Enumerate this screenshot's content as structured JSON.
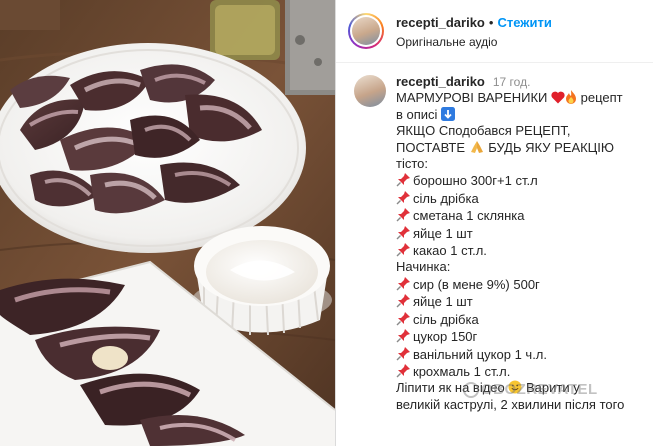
{
  "header": {
    "username": "recepti_dariko",
    "separator": "•",
    "follow_label": "Стежити",
    "audio_label": "Оригінальне аудіо"
  },
  "comment": {
    "username": "recepti_dariko",
    "time": "17 год.",
    "title_text": "МАРМУРОВІ ВАРЕНИКИ",
    "title_suffix": "рецепт",
    "line2": "в описі",
    "line3": "ЯКЩО Сподобався РЕЦЕПТ,",
    "line4a": "ПОСТАВТЕ",
    "line4b": "БУДЬ ЯКУ РЕАКЦІЮ",
    "dough_heading": "тісто:",
    "dough_items": [
      "борошно 300г+1 ст.л",
      "сіль дрібка",
      "сметана 1 склянка",
      "яйце 1 шт",
      "какао 1 ст.л."
    ],
    "filling_heading": "Начинка:",
    "filling_items": [
      "сир (в мене 9%) 500г",
      "яйце 1 шт",
      "сіль дрібка",
      "цукор 150г",
      "ванільний цукор 1 ч.л.",
      "крохмаль 1 ст.л."
    ],
    "closing_a": "Ліпити як на відео",
    "closing_b": "Варити у",
    "closing_c": "великій каструлі, 2 хвилини після того"
  },
  "watermark": "OBOZREVATEL",
  "icons": {
    "heart": "red-heart-icon",
    "fire": "fire-icon",
    "info": "info-icon",
    "pray": "folded-hands-icon",
    "pin": "pushpin-icon",
    "smile": "smiling-face-icon"
  },
  "colors": {
    "follow": "#0095f6",
    "text": "#262626",
    "muted": "#8e8e8e"
  }
}
